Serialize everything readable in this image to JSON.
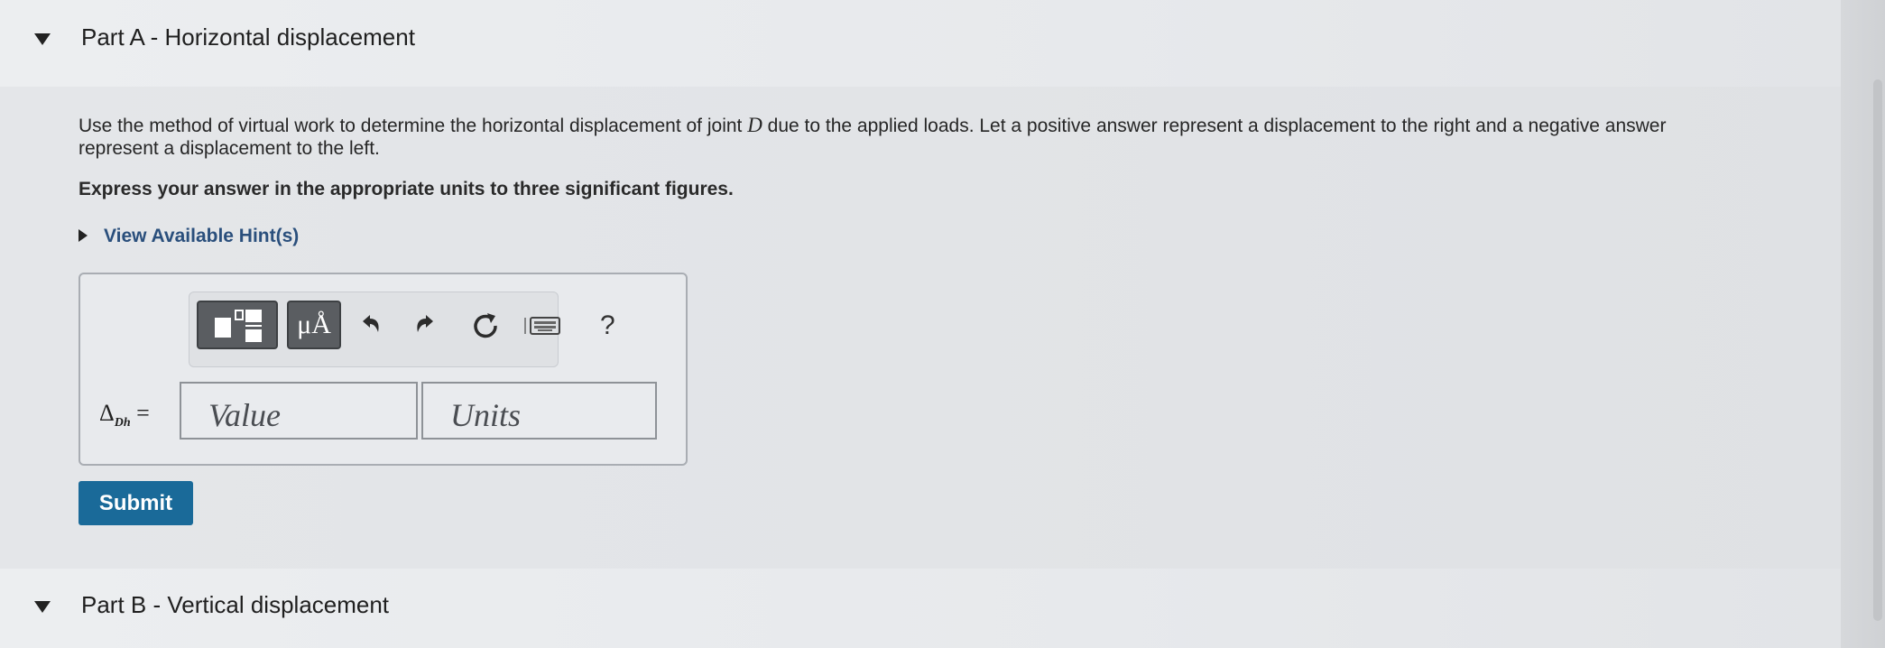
{
  "part_a": {
    "title": "Part A - Horizontal displacement",
    "prompt_line1_pre": "Use the method of virtual work to determine the horizontal displacement of joint ",
    "prompt_joint": "D",
    "prompt_line1_post": " due to the applied loads. Let a positive answer represent a displacement to the right and a negative answer",
    "prompt_line2": "represent a displacement to the left.",
    "instruction": "Express your answer in the appropriate units to three significant figures.",
    "hint_label": "View Available Hint(s)"
  },
  "answer": {
    "variable_symbol": "Δ",
    "variable_subscript": "Dh",
    "equals": "=",
    "value_placeholder": "Value",
    "units_placeholder": "Units",
    "toolbar": {
      "template_icon": "template-icon",
      "units_symbol": "μÅ",
      "undo_icon": "undo-icon",
      "redo_icon": "redo-icon",
      "reset_icon": "reset-icon",
      "keyboard_icon": "keyboard-icon",
      "help_label": "?"
    }
  },
  "submit_label": "Submit",
  "part_b": {
    "title": "Part B - Vertical displacement"
  },
  "colors": {
    "submit_bg": "#1a6a99",
    "hint_text": "#2a4f7c",
    "toolbar_dark": "#5a5d61"
  }
}
